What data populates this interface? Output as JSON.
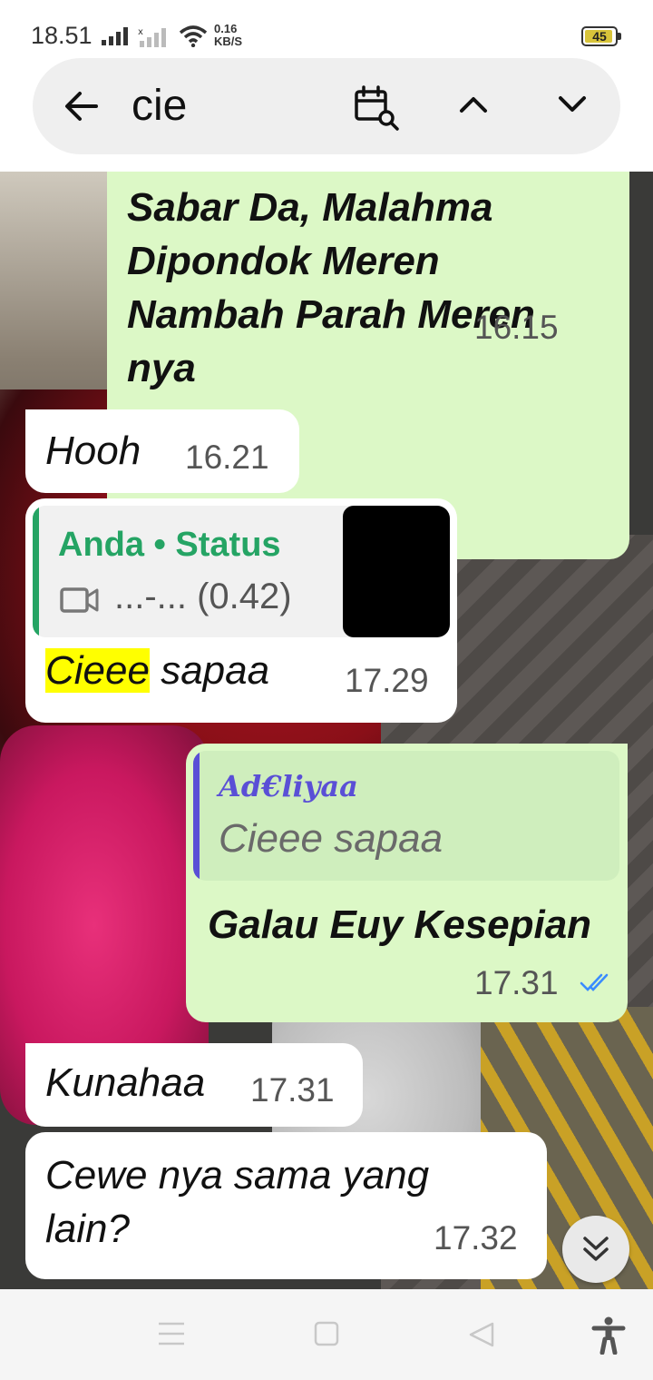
{
  "status_bar": {
    "time": "18.51",
    "network_speed_value": "0.16",
    "network_speed_unit": "KB/S",
    "battery_level": "45"
  },
  "search": {
    "query": "cie",
    "icons": [
      "back-arrow",
      "calendar-search",
      "chevron-up",
      "chevron-down"
    ]
  },
  "messages": [
    {
      "direction": "outgoing",
      "text_lines": [
        "Sabar Da, Malahma",
        "Dipondok Meren",
        "Nambah Parah Meren",
        "nya"
      ],
      "time": "16.15",
      "status": "read"
    },
    {
      "direction": "incoming",
      "text": "Hooh",
      "time": "16.21"
    },
    {
      "direction": "incoming",
      "quote": {
        "author": "Anda • Status",
        "snippet": "...-... (0.42)",
        "media": "video"
      },
      "highlighted": "Cieee",
      "text_rest": " sapaa",
      "time": "17.29"
    },
    {
      "direction": "outgoing",
      "reply_to": {
        "author": "Ad€liyaa",
        "text": "Cieee sapaa"
      },
      "text": "Galau Euy Kesepian",
      "time": "17.31",
      "status": "read"
    },
    {
      "direction": "incoming",
      "text": "Kunahaa",
      "time": "17.31"
    },
    {
      "direction": "incoming",
      "text_lines": [
        "Cewe nya sama yang",
        "lain?"
      ],
      "time": "17.32"
    }
  ],
  "colors": {
    "outgoing_bubble": "#dcf8c6",
    "incoming_bubble": "#ffffff",
    "status_quote_accent": "#25a464",
    "reply_accent": "#5a4fd6",
    "read_tick": "#3a8cff",
    "search_highlight": "#ffff00"
  },
  "nav_bar": {
    "icons": [
      "menu-icon",
      "home-icon",
      "back-icon",
      "accessibility-icon"
    ]
  }
}
